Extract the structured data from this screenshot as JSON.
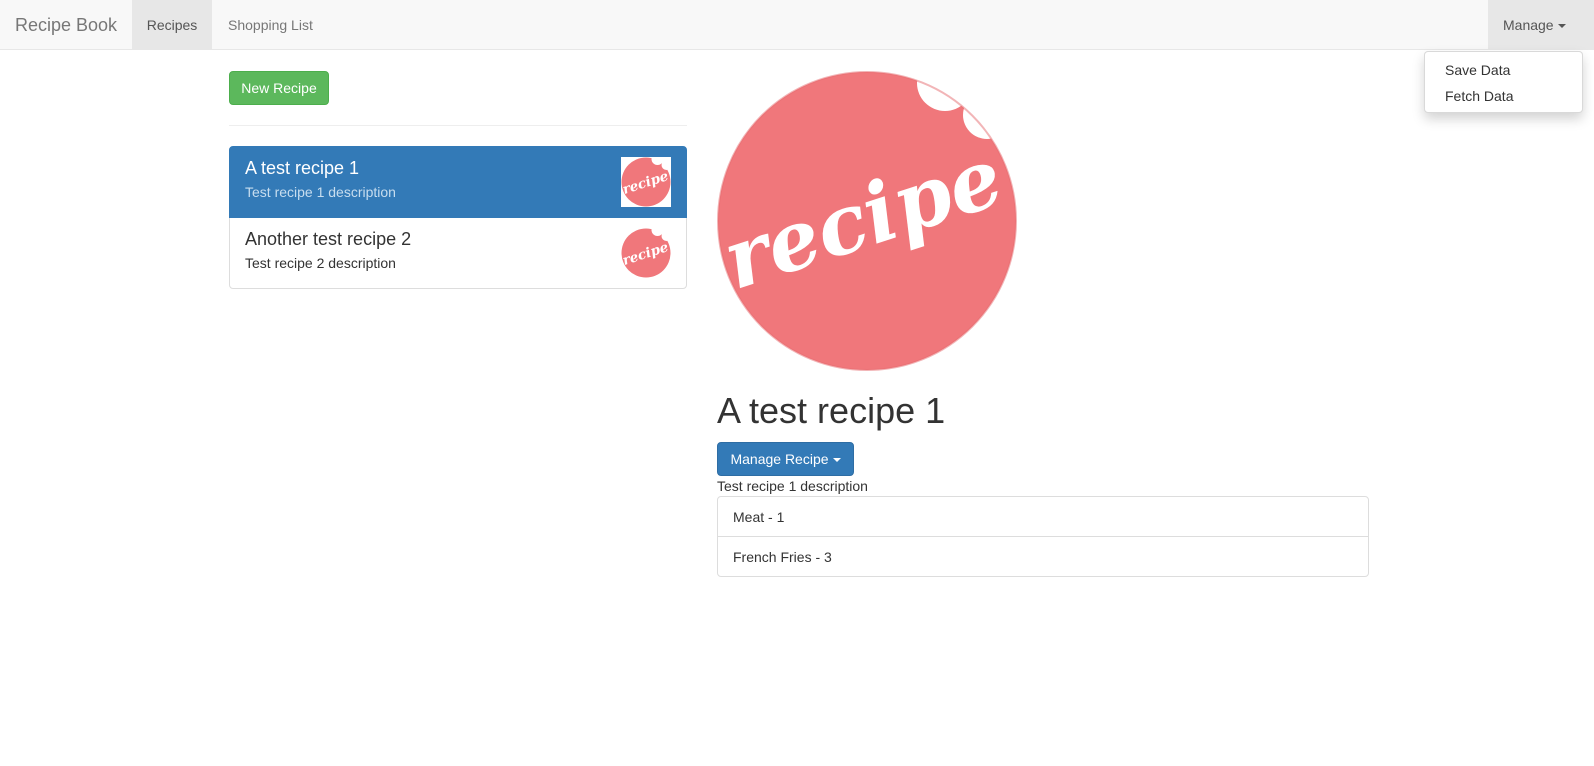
{
  "navbar": {
    "brand": "Recipe Book",
    "items": [
      {
        "label": "Recipes",
        "active": true
      },
      {
        "label": "Shopping List",
        "active": false
      }
    ],
    "manage_label": "Manage",
    "manage_menu": [
      "Save Data",
      "Fetch Data"
    ]
  },
  "sidebar": {
    "new_recipe_label": "New Recipe",
    "recipes": [
      {
        "name": "A test recipe 1",
        "description": "Test recipe 1 description",
        "active": true
      },
      {
        "name": "Another test recipe 2",
        "description": "Test recipe 2 description",
        "active": false
      }
    ]
  },
  "detail": {
    "image_text": "recipe",
    "title": "A test recipe 1",
    "manage_button_label": "Manage Recipe",
    "description": "Test recipe 1 description",
    "ingredients": [
      "Meat - 1",
      "French Fries - 3"
    ]
  },
  "colors": {
    "primary": "#337ab7",
    "success": "#5cb85c",
    "recipe_logo": "#f0777b"
  }
}
